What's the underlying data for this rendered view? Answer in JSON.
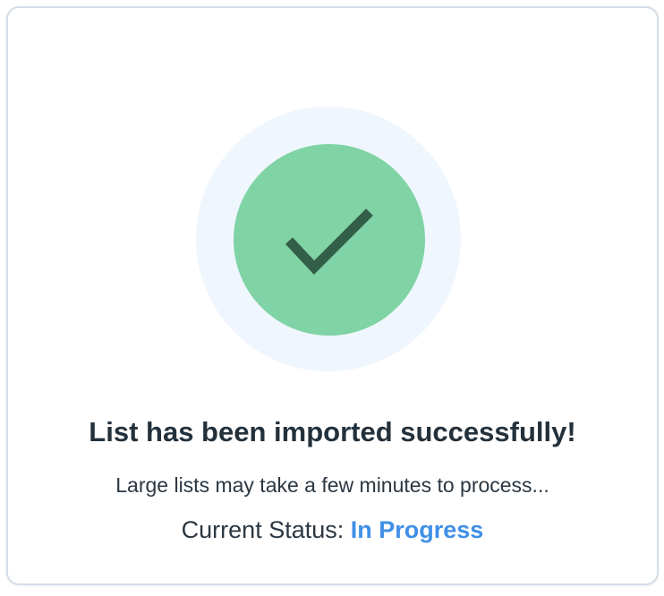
{
  "dialog": {
    "title": "List has been imported successfully!",
    "message": "Large lists may take a few minutes to process...",
    "status_label": "Current Status:",
    "status_value": "In Progress",
    "icon": "checkmark-icon"
  },
  "colors": {
    "halo": "#eff6fd",
    "badge": "#80d3a5",
    "checkmark": "#335e48",
    "title_text": "#23313c",
    "body_text": "#2b3742",
    "status_accent": "#3f8fe6",
    "card_border": "#d5dde8"
  }
}
